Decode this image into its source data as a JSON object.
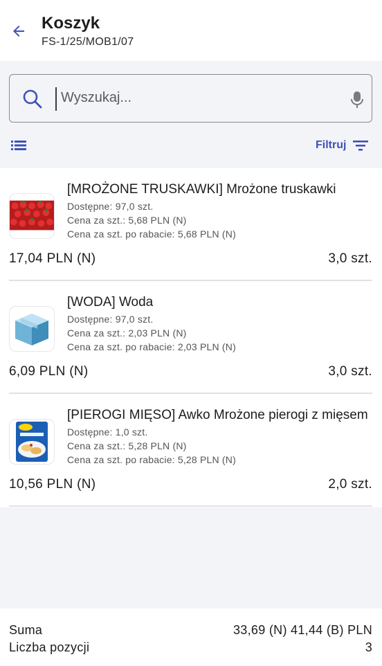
{
  "header": {
    "title": "Koszyk",
    "subtitle": "FS-1/25/MOB1/07"
  },
  "search": {
    "placeholder": "Wyszukaj..."
  },
  "toolbar": {
    "filter_label": "Filtruj"
  },
  "items": [
    {
      "name": "[MROŻONE TRUSKAWKI] Mrożone truskawki",
      "available": "Dostępne: 97,0 szt.",
      "unit_price": "Cena za szt.: 5,68 PLN (N)",
      "discount_price": "Cena za szt. po rabacie: 5,68 PLN (N)",
      "total": "17,04 PLN (N)",
      "quantity": "3,0 szt.",
      "image": "strawberries-image"
    },
    {
      "name": "[WODA] Woda",
      "available": "Dostępne: 97,0 szt.",
      "unit_price": "Cena za szt.: 2,03 PLN (N)",
      "discount_price": "Cena za szt. po rabacie: 2,03 PLN (N)",
      "total": "6,09 PLN (N)",
      "quantity": "3,0 szt.",
      "image": "box-icon"
    },
    {
      "name": "[PIEROGI MIĘSO] Awko Mrożone pierogi z mięsem",
      "available": "Dostępne: 1,0 szt.",
      "unit_price": "Cena za szt.: 5,28 PLN (N)",
      "discount_price": "Cena za szt. po rabacie: 5,28 PLN (N)",
      "total": "10,56 PLN (N)",
      "quantity": "2,0 szt.",
      "image": "pierogi-package-image"
    }
  ],
  "summary": {
    "sum_label": "Suma",
    "sum_value": "33,69 (N) 41,44 (B) PLN",
    "count_label": "Liczba pozycji",
    "count_value": "3"
  },
  "colors": {
    "accent": "#3f51b5",
    "background": "#f3f4f8"
  }
}
